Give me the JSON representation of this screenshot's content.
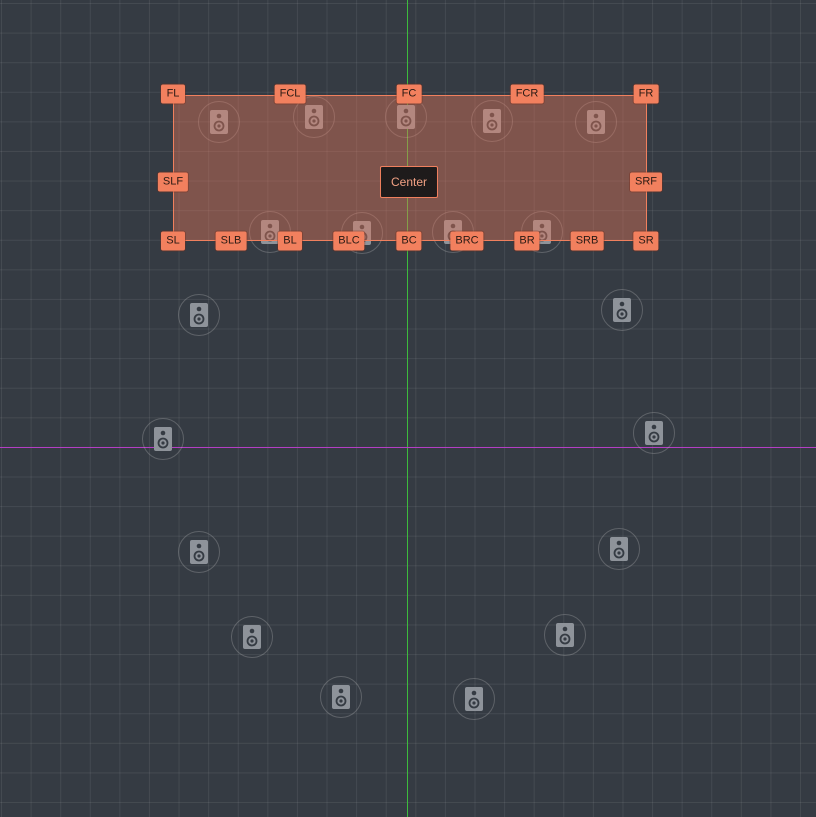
{
  "zone": {
    "center_label": "Center",
    "handles": [
      {
        "label": "FL",
        "name": "handle-fl"
      },
      {
        "label": "FCL",
        "name": "handle-fcl"
      },
      {
        "label": "FC",
        "name": "handle-fc"
      },
      {
        "label": "FCR",
        "name": "handle-fcr"
      },
      {
        "label": "FR",
        "name": "handle-fr"
      },
      {
        "label": "SLF",
        "name": "handle-slf"
      },
      {
        "label": "SRF",
        "name": "handle-srf"
      },
      {
        "label": "SL",
        "name": "handle-sl"
      },
      {
        "label": "SLB",
        "name": "handle-slb"
      },
      {
        "label": "BL",
        "name": "handle-bl"
      },
      {
        "label": "BLC",
        "name": "handle-blc"
      },
      {
        "label": "BC",
        "name": "handle-bc"
      },
      {
        "label": "BRC",
        "name": "handle-brc"
      },
      {
        "label": "BR",
        "name": "handle-br"
      },
      {
        "label": "SRB",
        "name": "handle-srb"
      },
      {
        "label": "SR",
        "name": "handle-sr"
      }
    ]
  },
  "speaker_icon": "speaker-icon",
  "colors": {
    "background": "#353b43",
    "zone_fill": "#e8785a",
    "handle": "#f2805e",
    "y_axis": "#3dbb3d",
    "x_axis": "#b43ec4"
  }
}
